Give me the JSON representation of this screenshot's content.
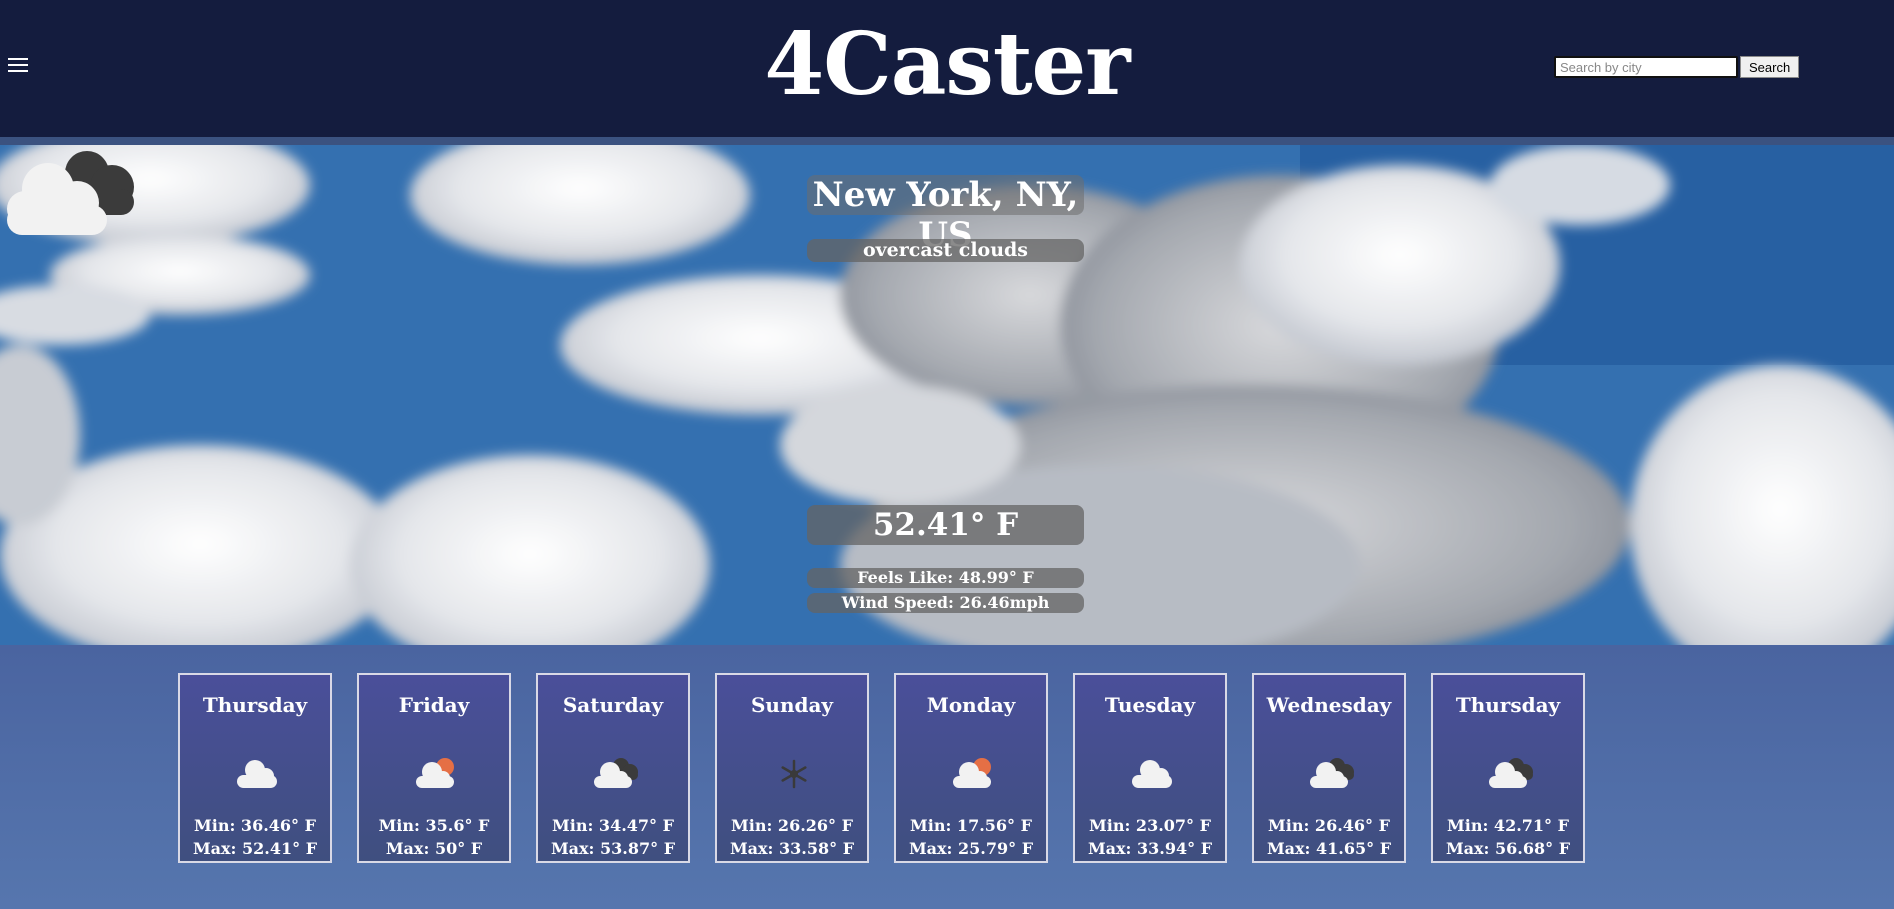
{
  "app": {
    "title": "4Caster"
  },
  "search": {
    "placeholder": "Search by city",
    "value": "",
    "button_label": "Search"
  },
  "current": {
    "location": "New York, NY, US",
    "description": "overcast clouds",
    "icon": "overcast-clouds-icon",
    "temperature": "52.41° F",
    "feels_like": "Feels Like: 48.99° F",
    "wind_speed": "Wind Speed: 26.46mph"
  },
  "forecast": [
    {
      "day": "Thursday",
      "icon": "few-clouds-icon",
      "min": "Min: 36.46° F",
      "max": "Max: 52.41° F"
    },
    {
      "day": "Friday",
      "icon": "partly-sunny-icon",
      "min": "Min: 35.6° F",
      "max": "Max: 50° F"
    },
    {
      "day": "Saturday",
      "icon": "broken-clouds-icon",
      "min": "Min: 34.47° F",
      "max": "Max: 53.87° F"
    },
    {
      "day": "Sunday",
      "icon": "snow-icon",
      "min": "Min: 26.26° F",
      "max": "Max: 33.58° F"
    },
    {
      "day": "Monday",
      "icon": "partly-sunny-icon",
      "min": "Min: 17.56° F",
      "max": "Max: 25.79° F"
    },
    {
      "day": "Tuesday",
      "icon": "few-clouds-icon",
      "min": "Min: 23.07° F",
      "max": "Max: 33.94° F"
    },
    {
      "day": "Wednesday",
      "icon": "broken-clouds-icon",
      "min": "Min: 26.46° F",
      "max": "Max: 41.65° F"
    },
    {
      "day": "Thursday",
      "icon": "broken-clouds-icon",
      "min": "Min: 42.71° F",
      "max": "Max: 56.68° F"
    }
  ]
}
